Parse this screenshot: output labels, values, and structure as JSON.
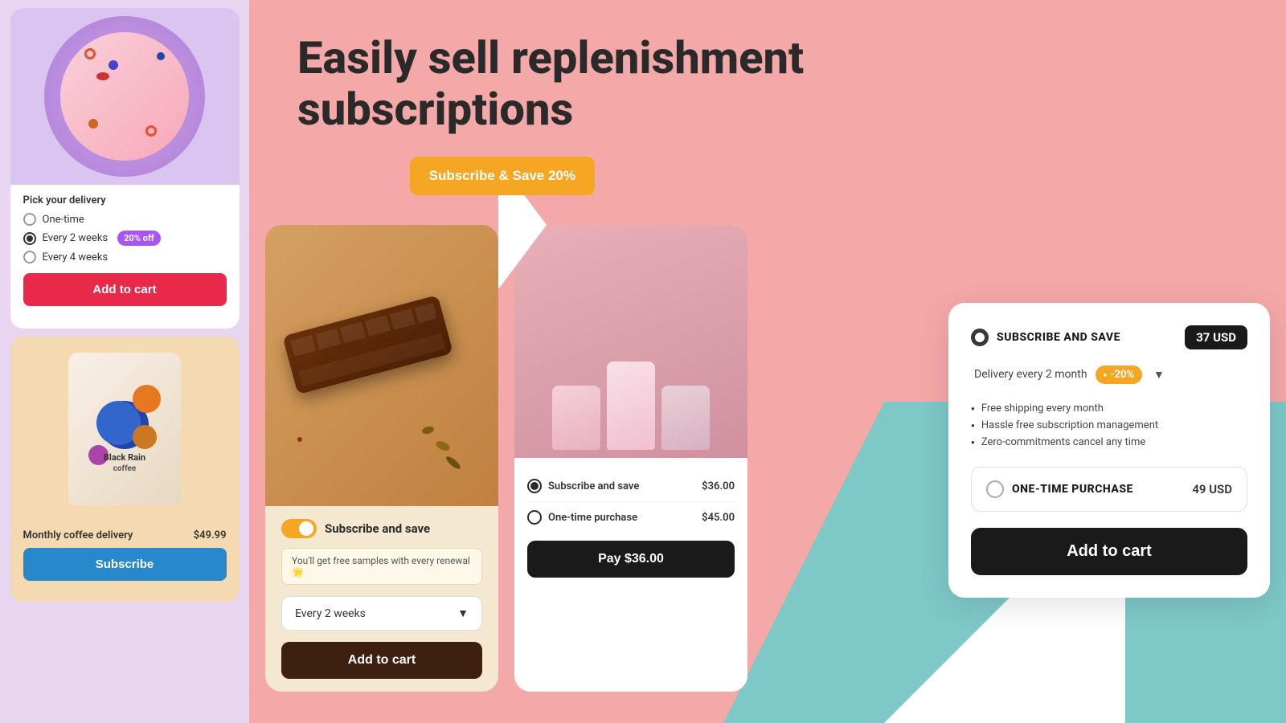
{
  "hero": {
    "title_line1": "Easily sell replenishment",
    "title_line2": "subscriptions"
  },
  "subscribe_save_btn": "Subscribe & Save 20%",
  "card_cereal": {
    "delivery_label": "Pick your delivery",
    "options": [
      {
        "label": "One-time",
        "selected": false
      },
      {
        "label": "Every 2 weeks",
        "selected": true,
        "badge": "20% off"
      },
      {
        "label": "Every 4 weeks",
        "selected": false
      }
    ],
    "add_to_cart": "Add to cart"
  },
  "card_coffee": {
    "product_name": "Black Rain",
    "product_sub": "coffee",
    "title": "Monthly coffee delivery",
    "price": "$49.99",
    "subscribe_btn": "Subscribe"
  },
  "card_choco": {
    "toggle_label": "Subscribe and save",
    "free_samples": "You'll get free samples with every renewal 🌟",
    "frequency": "Every 2 weeks",
    "add_to_cart": "Add to cart"
  },
  "card_dogfood": {
    "options": [
      {
        "label": "Subscribe and save",
        "price": "$36.00",
        "selected": true
      },
      {
        "label": "One-time purchase",
        "price": "$45.00",
        "selected": false
      }
    ],
    "pay_btn": "Pay  $36.00"
  },
  "widget": {
    "subscribe_label": "SUBSCRIBE AND SAVE",
    "subscribe_price": "37 USD",
    "delivery_text": "Delivery every 2 month",
    "discount": "-20%",
    "benefits": [
      "Free shipping every month",
      "Hassle free subscription management",
      "Zero-commitments cancel any time"
    ],
    "onetime_label": "ONE-TIME PURCHASE",
    "onetime_price": "49 USD",
    "add_to_cart": "Add to cart"
  }
}
